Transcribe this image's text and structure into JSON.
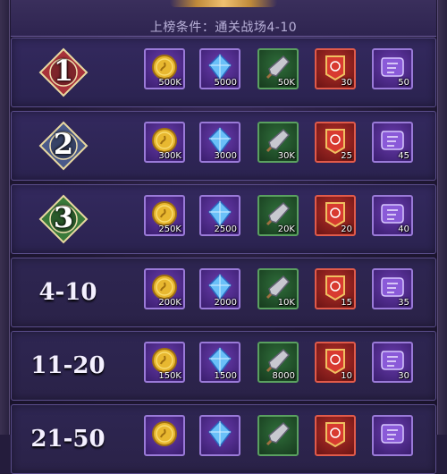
{
  "header": {
    "condition": "上榜条件：通关战场4-10"
  },
  "colors": {
    "gold_badge": "#a8323a",
    "silver_badge": "#4a5a8a",
    "bronze_badge": "#3a7a3a"
  },
  "item_icons": [
    "gold-coin-icon",
    "blue-crystal-icon",
    "arrowhead-icon",
    "red-banner-icon",
    "purple-scroll-icon"
  ],
  "rows": [
    {
      "rank": "1",
      "rewards": [
        "500K",
        "5000",
        "50K",
        "30",
        "50"
      ]
    },
    {
      "rank": "2",
      "rewards": [
        "300K",
        "3000",
        "30K",
        "25",
        "45"
      ]
    },
    {
      "rank": "3",
      "rewards": [
        "250K",
        "2500",
        "20K",
        "20",
        "40"
      ]
    },
    {
      "rank": "4-10",
      "rewards": [
        "200K",
        "2000",
        "10K",
        "15",
        "35"
      ]
    },
    {
      "rank": "11-20",
      "rewards": [
        "150K",
        "1500",
        "8000",
        "10",
        "30"
      ]
    },
    {
      "rank": "21-50",
      "rewards": [
        "",
        "",
        "",
        "",
        ""
      ]
    }
  ]
}
